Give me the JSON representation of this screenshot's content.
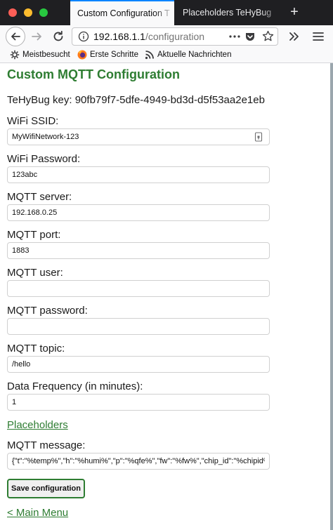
{
  "browser": {
    "tabs": [
      {
        "title": "Custom Configuration T",
        "active": true
      },
      {
        "title": "Placeholders TeHyBug",
        "active": false
      }
    ],
    "new_tab_label": "+",
    "url_host": "192.168.1.1",
    "url_path": "/configuration",
    "bookmarks": [
      "Meistbesucht",
      "Erste Schritte",
      "Aktuelle Nachrichten"
    ]
  },
  "colors": {
    "accent": "#2e7d32",
    "tab_accent": "#0a84ff"
  },
  "page": {
    "title": "Custom MQTT Configuration",
    "key_label": "TeHyBug key:",
    "key_value": "90fb79f7-5dfe-4949-bd3d-d5f53aa2e1eb",
    "fields": {
      "ssid": {
        "label": "WiFi SSID:",
        "value": "MyWifiNetwork-123"
      },
      "password": {
        "label": "WiFi Password:",
        "value": "123abc"
      },
      "server": {
        "label": "MQTT server:",
        "value": "192.168.0.25"
      },
      "port": {
        "label": "MQTT port:",
        "value": "1883"
      },
      "user": {
        "label": "MQTT user:",
        "value": ""
      },
      "mqtt_password": {
        "label": "MQTT password:",
        "value": ""
      },
      "topic": {
        "label": "MQTT topic:",
        "value": "/hello"
      },
      "frequency": {
        "label": "Data Frequency (in minutes):",
        "value": "1"
      },
      "message": {
        "label": "MQTT message:",
        "value": "{\"t\":\"%temp%\",\"h\":\"%humi%\",\"p\":\"%qfe%\",\"fw\":\"%fw%\",\"chip_id\":\"%chipid%\","
      }
    },
    "placeholders_link": "Placeholders",
    "save_label": "Save configuration",
    "main_menu_link": "< Main Menu"
  }
}
